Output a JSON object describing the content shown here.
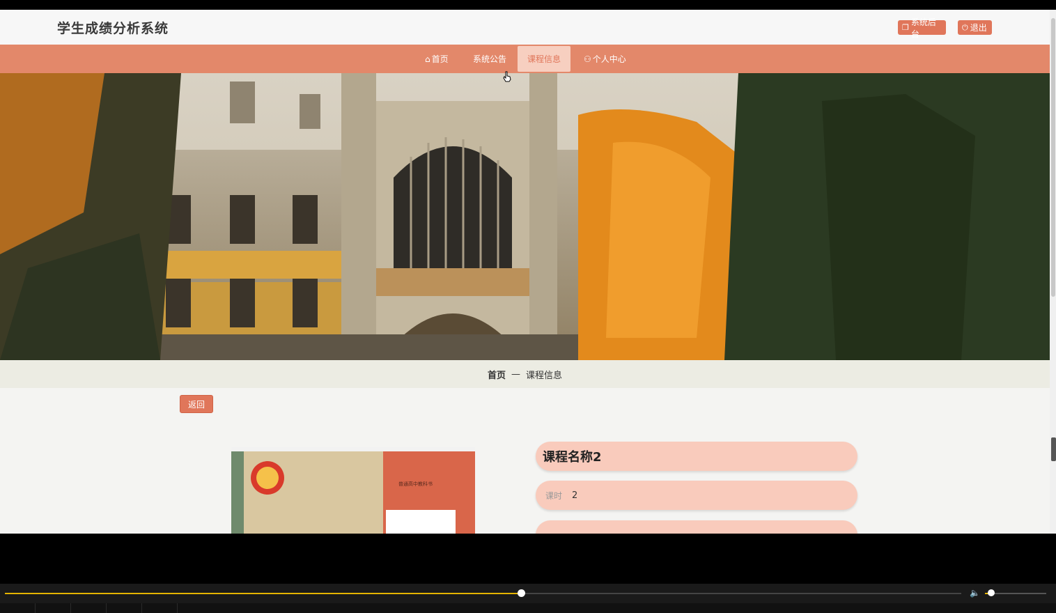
{
  "header": {
    "site_title": "学生成绩分析系统",
    "admin_button": "系统后台",
    "logout_button": "退出"
  },
  "nav": {
    "items": [
      {
        "label": "首页",
        "icon": "home-icon"
      },
      {
        "label": "系统公告",
        "icon": ""
      },
      {
        "label": "课程信息",
        "icon": "",
        "active": true
      },
      {
        "label": "个人中心",
        "icon": "user-icon"
      }
    ]
  },
  "breadcrumb": {
    "home": "首页",
    "separator": "—",
    "current": "课程信息"
  },
  "actions": {
    "back_button": "返回"
  },
  "course": {
    "name": "课程名称2",
    "hours_label": "课时",
    "hours_value": "2"
  },
  "book_cover": {
    "publisher_text": "普通高中教科书"
  },
  "player": {
    "progress": 0.54,
    "volume": 0.1
  },
  "colors": {
    "accent": "#e0765a",
    "nav_bg": "#e3886a",
    "pill_bg": "#f9cbbc",
    "progress": "#e5b400"
  }
}
